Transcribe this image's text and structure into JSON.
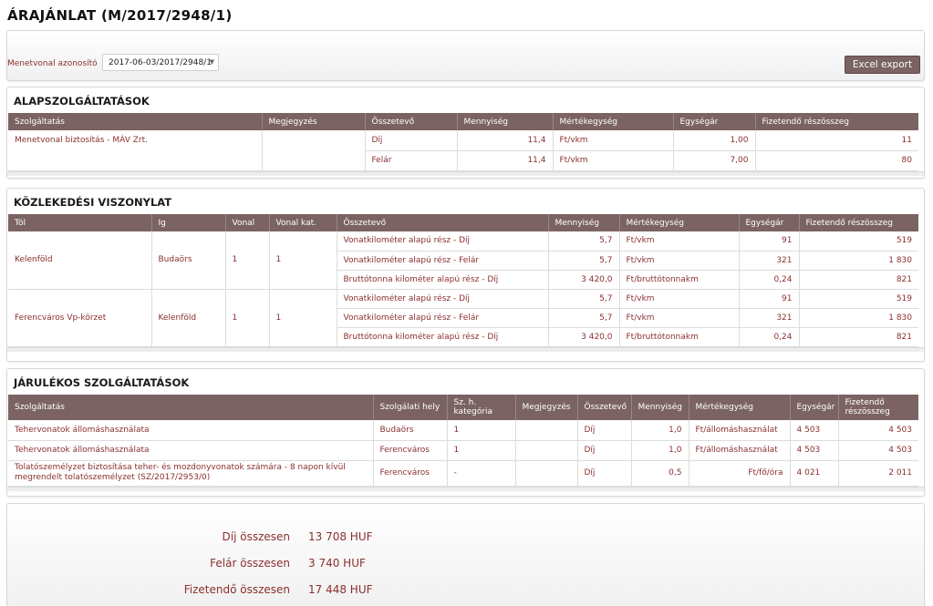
{
  "page": {
    "title": "ÁRAJÁNLAT (M/2017/2948/1)"
  },
  "filter": {
    "label": "Menetvonal azonosító",
    "selected": "2017-06-03/2017/2948/1",
    "export_label": "Excel export"
  },
  "basic": {
    "title": "ALAPSZOLGÁLTATÁSOK",
    "headers": [
      "Szolgáltatás",
      "Megjegyzés",
      "Összetevő",
      "Mennyiség",
      "Mértékegység",
      "Egységár",
      "Fizetendő részösszeg"
    ],
    "service": "Menetvonal biztosítás - MÁV Zrt.",
    "note": "",
    "rows": [
      {
        "component": "Díj",
        "quantity": "11,4",
        "unit": "Ft/vkm",
        "unit_price": "1,00",
        "subtotal": "11"
      },
      {
        "component": "Felár",
        "quantity": "11,4",
        "unit": "Ft/vkm",
        "unit_price": "7,00",
        "subtotal": "80"
      }
    ]
  },
  "transport": {
    "title": "KÖZLEKEDÉSI VISZONYLAT",
    "headers": [
      "Tól",
      "Ig",
      "Vonal",
      "Vonal kat.",
      "Összetevő",
      "Mennyiség",
      "Mértékegység",
      "Egységár",
      "Fizetendő részösszeg"
    ],
    "groups": [
      {
        "from": "Kelenföld",
        "to": "Budaörs",
        "line": "1",
        "line_cat": "1",
        "rows": [
          {
            "component": "Vonatkilométer alapú rész - Díj",
            "quantity": "5,7",
            "unit": "Ft/vkm",
            "unit_price": "91",
            "subtotal": "519"
          },
          {
            "component": "Vonatkilométer alapú rész - Felár",
            "quantity": "5,7",
            "unit": "Ft/vkm",
            "unit_price": "321",
            "subtotal": "1 830"
          },
          {
            "component": "Bruttótonna kilométer alapú rész - Díj",
            "quantity": "3 420,0",
            "unit": "Ft/bruttótonnakm",
            "unit_price": "0,24",
            "subtotal": "821"
          }
        ]
      },
      {
        "from": "Ferencváros Vp-körzet",
        "to": "Kelenföld",
        "line": "1",
        "line_cat": "1",
        "rows": [
          {
            "component": "Vonatkilométer alapú rész - Díj",
            "quantity": "5,7",
            "unit": "Ft/vkm",
            "unit_price": "91",
            "subtotal": "519"
          },
          {
            "component": "Vonatkilométer alapú rész - Felár",
            "quantity": "5,7",
            "unit": "Ft/vkm",
            "unit_price": "321",
            "subtotal": "1 830"
          },
          {
            "component": "Bruttótonna kilométer alapú rész - Díj",
            "quantity": "3 420,0",
            "unit": "Ft/bruttótonnakm",
            "unit_price": "0,24",
            "subtotal": "821"
          }
        ]
      }
    ]
  },
  "ancillary": {
    "title": "JÁRULÉKOS SZOLGÁLTATÁSOK",
    "headers": [
      "Szolgáltatás",
      "Szolgálati hely",
      "Sz. h. kategória",
      "Megjegyzés",
      "Összetevő",
      "Mennyiség",
      "Mértékegység",
      "Egységár",
      "Fizetendő részösszeg"
    ],
    "rows": [
      {
        "service": "Tehervonatok állomáshasználata",
        "place": "Budaörs",
        "category": "1",
        "note": "",
        "component": "Díj",
        "quantity": "1,0",
        "unit": "Ft/állomáshasználat",
        "unit_price": "4 503",
        "subtotal": "4 503"
      },
      {
        "service": "Tehervonatok állomáshasználata",
        "place": "Ferencváros",
        "category": "1",
        "note": "",
        "component": "Díj",
        "quantity": "1,0",
        "unit": "Ft/állomáshasználat",
        "unit_price": "4 503",
        "subtotal": "4 503"
      },
      {
        "service": "Tolatószemélyzet biztosítása teher- és mozdonyvonatok számára - 8 napon kívül megrendelt tolatószemélyzet (SZ/2017/2953/0)",
        "place": "Ferencváros",
        "category": "-",
        "note": "",
        "component": "Díj",
        "quantity": "0,5",
        "unit": "Ft/fő/óra",
        "unit_price": "4 021",
        "subtotal": "2 011"
      }
    ]
  },
  "summary": {
    "fee_label": "Díj összesen",
    "fee_value": "13 708 HUF",
    "surcharge_label": "Felár összesen",
    "surcharge_value": "3 740 HUF",
    "total_label": "Fizetendő összesen",
    "total_value": "17 448 HUF"
  }
}
